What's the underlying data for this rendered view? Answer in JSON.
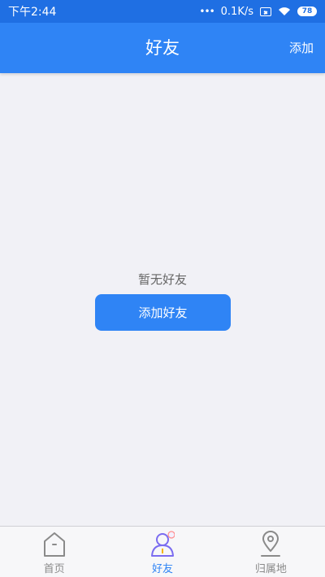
{
  "status_bar": {
    "time": "下午2:44",
    "net_speed": "0.1K/s",
    "battery": "78"
  },
  "header": {
    "title": "好友",
    "add_label": "添加"
  },
  "empty_state": {
    "message": "暂无好友",
    "button_label": "添加好友"
  },
  "tabs": [
    {
      "label": "首页",
      "icon": "home-icon",
      "active": false
    },
    {
      "label": "好友",
      "icon": "friend-icon",
      "active": true
    },
    {
      "label": "归属地",
      "icon": "location-icon",
      "active": false
    }
  ],
  "colors": {
    "primary": "#2f84f5",
    "status_bar": "#1f6fe3",
    "background": "#f1f1f6",
    "friend_icon": "#7b6cf0"
  }
}
